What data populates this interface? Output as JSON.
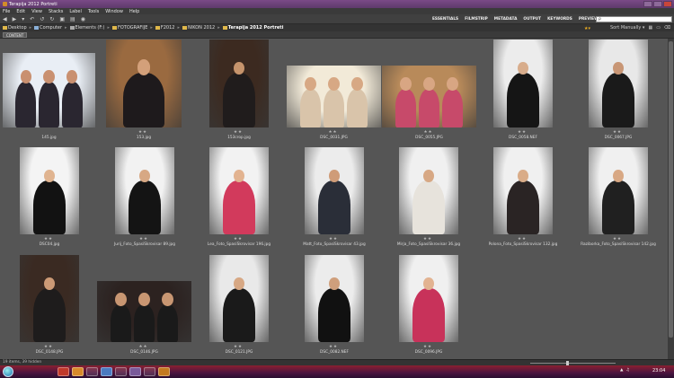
{
  "window": {
    "title": "Terapija 2012 Portreti"
  },
  "menu": [
    "File",
    "Edit",
    "View",
    "Stacks",
    "Label",
    "Tools",
    "Window",
    "Help"
  ],
  "workspaces": [
    "ESSENTIALS",
    "FILMSTRIP",
    "METADATA",
    "OUTPUT",
    "KEYWORDS",
    "PREVIEW"
  ],
  "search": {
    "placeholder": "ρ"
  },
  "path": [
    {
      "label": "Desktop"
    },
    {
      "label": "Computer"
    },
    {
      "label": "Elements (F:)"
    },
    {
      "label": "FOTOGRAFIJE"
    },
    {
      "label": "F2012"
    },
    {
      "label": "NIKON 2012"
    },
    {
      "label": "Terapija 2012 Portreti"
    }
  ],
  "sort": {
    "label": "Sort Manually"
  },
  "content_tab": {
    "label": "CONTENT"
  },
  "thumbnails": [
    {
      "name": "145.jpg",
      "stars": "",
      "bg": "#e9eef5",
      "fig": "#2a2630",
      "skin": "#c99070"
    },
    {
      "name": "153.jpg",
      "stars": "★★",
      "bg": "#9a6a40",
      "fig": "#1e1a1c",
      "skin": "#d3a07a"
    },
    {
      "name": "153crop.jpg",
      "stars": "★★",
      "bg": "#3c2a20",
      "fig": "#201c1c",
      "skin": "#c6946c"
    },
    {
      "name": "DSC_0031.JPG",
      "stars": "★★",
      "bg": "#f2ead8",
      "fig": "#d9c4aa",
      "skin": "#d7a884"
    },
    {
      "name": "DSC_0055.JPG",
      "stars": "★★",
      "bg": "#b88a5a",
      "fig": "#c74a6a",
      "skin": "#d8a683"
    },
    {
      "name": "DSC_0058.NEF",
      "stars": "★★",
      "bg": "#ececec",
      "fig": "#151515",
      "skin": "#d8ad8c"
    },
    {
      "name": "DSC_0067.JPG",
      "stars": "★★",
      "bg": "#e8e8e8",
      "fig": "#1a1a1a",
      "skin": "#c89675"
    },
    {
      "name": "DSC04.jpg",
      "stars": "★★",
      "bg": "#f4f4f4",
      "fig": "#121212",
      "skin": "#e0b490"
    },
    {
      "name": "Jurij_Foto_SpasiSkrovisar 89.jpg",
      "stars": "★★",
      "bg": "#f2f2f2",
      "fig": "#141414",
      "skin": "#d7a884"
    },
    {
      "name": "Lea_Foto_SpasiSkrovisar 196.jpg",
      "stars": "★★",
      "bg": "#f2f2f2",
      "fig": "#d23a5c",
      "skin": "#e2b390"
    },
    {
      "name": "Matt_Foto_SpasiSkrovisar 43.jpg",
      "stars": "★★",
      "bg": "#ececec",
      "fig": "#2a2e38",
      "skin": "#cf9c78"
    },
    {
      "name": "Mirja_Foto_SpasiSkrovisar 36.jpg",
      "stars": "★★",
      "bg": "#f0f0f0",
      "fig": "#e7e3dc",
      "skin": "#d7a884"
    },
    {
      "name": "Polona_Foto_SpasiSkrovisar 132.jpg",
      "stars": "★★",
      "bg": "#f0f0f0",
      "fig": "#2a2424",
      "skin": "#d9ac88"
    },
    {
      "name": "Raziborka_Foto_SpasiSkrovisar 142.jpg",
      "stars": "★★",
      "bg": "#f0f0f0",
      "fig": "#202020",
      "skin": "#d8a884"
    },
    {
      "name": "DSC_0148.JPG",
      "stars": "★★",
      "bg": "#3a2a22",
      "fig": "#1e1c1c",
      "skin": "#cc9a76"
    },
    {
      "name": "DSC_0146.JPG",
      "stars": "★★",
      "bg": "#2c2220",
      "fig": "#1a1a1a",
      "skin": "#c89672"
    },
    {
      "name": "DSC_0121.JPG",
      "stars": "★★",
      "bg": "#e9e9e9",
      "fig": "#1a1a1a",
      "skin": "#d7a884"
    },
    {
      "name": "DSC_0082.NEF",
      "stars": "★★",
      "bg": "#ececec",
      "fig": "#111111",
      "skin": "#cf9f7c"
    },
    {
      "name": "DSC_0096.JPG",
      "stars": "★★",
      "bg": "#f0f0f0",
      "fig": "#c8325a",
      "skin": "#e2b391"
    }
  ],
  "status": {
    "text": "19 items, 39 hidden"
  },
  "clock": {
    "time": "23:04"
  }
}
